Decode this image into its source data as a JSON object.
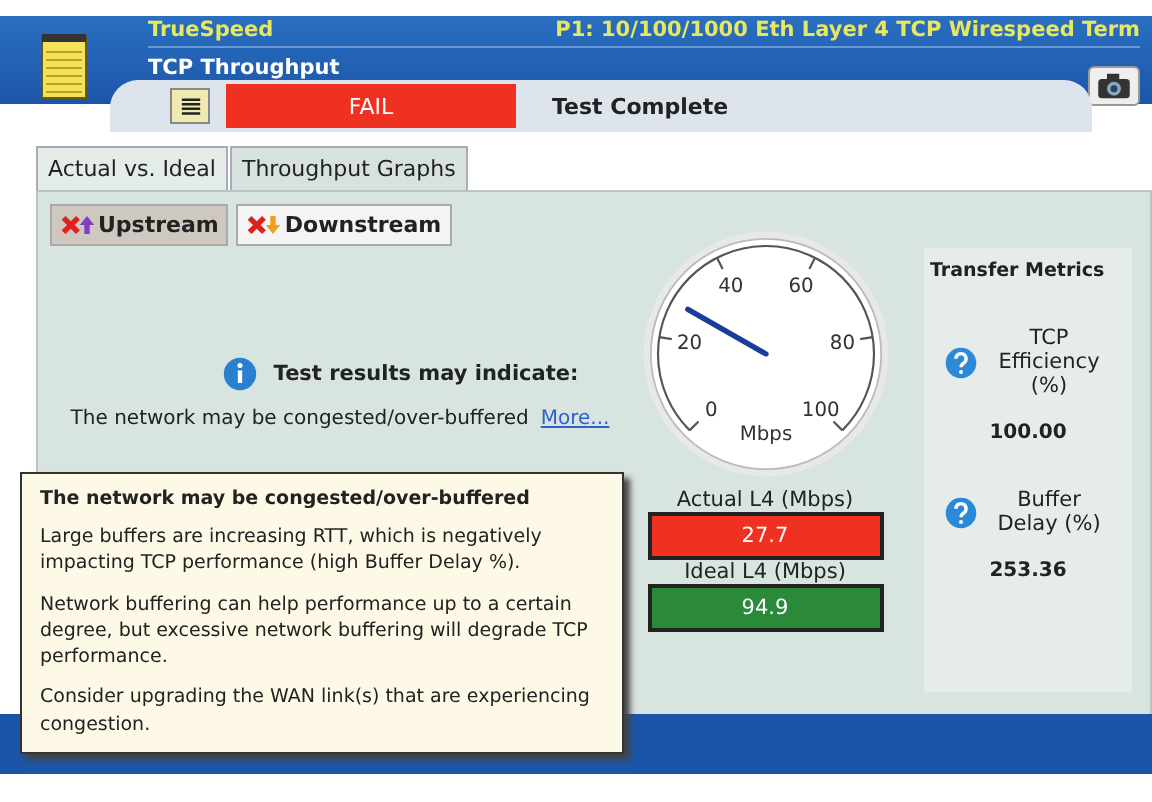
{
  "header": {
    "app": "TrueSpeed",
    "title": "TCP Throughput",
    "port": "P1: 10/100/1000 Eth Layer 4 TCP Wirespeed Term"
  },
  "status": {
    "result": "FAIL",
    "message": "Test Complete"
  },
  "tabs": [
    {
      "label": "Actual vs. Ideal",
      "selected": true
    },
    {
      "label": "Throughput Graphs",
      "selected": false
    }
  ],
  "directions": [
    {
      "label": "Upstream",
      "selected": true,
      "kind": "up"
    },
    {
      "label": "Downstream",
      "selected": false,
      "kind": "down"
    }
  ],
  "notice": {
    "heading": "Test results may indicate:",
    "text": "The network may be congested/over-buffered",
    "link": "More..."
  },
  "gauge": {
    "ticks": [
      "0",
      "20",
      "40",
      "60",
      "80",
      "100"
    ],
    "unit": "Mbps",
    "level": 0.277
  },
  "readouts": [
    {
      "label": "Actual L4 (Mbps)",
      "value": "27.7",
      "color": "#f03020"
    },
    {
      "label": "Ideal L4 (Mbps)",
      "value": "94.9",
      "color": "#2a8a3a"
    }
  ],
  "metrics": {
    "title": "Transfer Metrics",
    "items": [
      {
        "label": "TCP Efficiency (%)",
        "value": "100.00"
      },
      {
        "label": "Buffer Delay (%)",
        "value": "253.36"
      }
    ]
  },
  "tooltip": {
    "title": "The network may be congested/over-buffered",
    "paragraphs": [
      "Large buffers are increasing RTT, which is negatively impacting TCP performance (high Buffer Delay %).",
      "Network buffering can help performance up to a certain degree, but excessive network buffering will degrade TCP performance.",
      "Consider upgrading the WAN link(s) that are experiencing congestion."
    ]
  }
}
